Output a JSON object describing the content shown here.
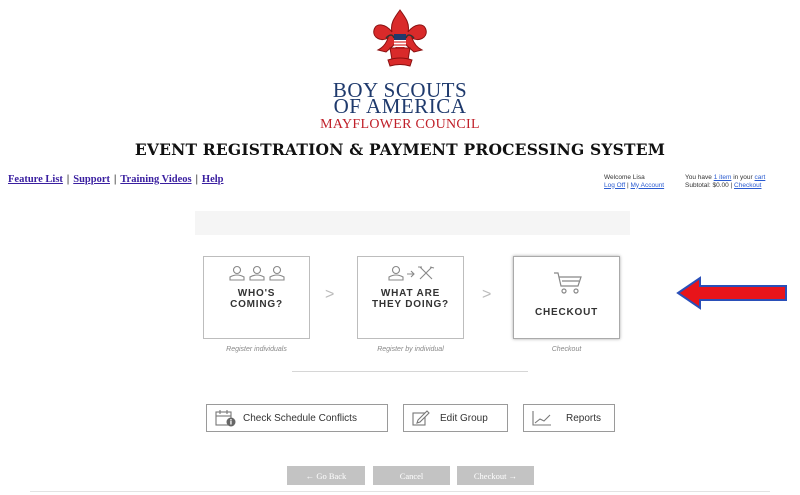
{
  "brand": {
    "line1": "BOY SCOUTS",
    "line2": "OF AMERICA",
    "council": "MAYFLOWER COUNCIL",
    "colors": {
      "navy": "#1f3a6d",
      "red": "#c0202a"
    }
  },
  "system_title": "EVENT REGISTRATION & PAYMENT PROCESSING SYSTEM",
  "top_nav": {
    "items": [
      "Feature List",
      "Support",
      "Training Videos",
      "Help"
    ],
    "separator": "|"
  },
  "account": {
    "welcome": "Welcome Lisa",
    "log_off": "Log Off",
    "my_account": "My Account",
    "cart_prefix": "You have ",
    "cart_items": "1 item",
    "cart_mid": " in your ",
    "cart_link": "cart",
    "subtotal": "Subtotal: $0.00 | ",
    "checkout": "Checkout"
  },
  "steps": [
    {
      "title_1": "WHO'S",
      "title_2": "COMING?",
      "caption": "Register individuals",
      "icon": "people-icon"
    },
    {
      "title_1": "WHAT ARE",
      "title_2": "THEY DOING?",
      "caption": "Register by individual",
      "icon": "activity-tools-icon"
    },
    {
      "title_1": "CHECKOUT",
      "title_2": "",
      "caption": "Checkout",
      "icon": "cart-icon"
    }
  ],
  "tools": {
    "schedule": "Check Schedule Conflicts",
    "edit_group": "Edit Group",
    "reports": "Reports"
  },
  "nav_buttons": {
    "back": "← Go Back",
    "cancel": "Cancel",
    "checkout": "Checkout →"
  },
  "annotation": {
    "arrow_color": "#e8141a",
    "arrow_outline": "#2a4fb8"
  }
}
